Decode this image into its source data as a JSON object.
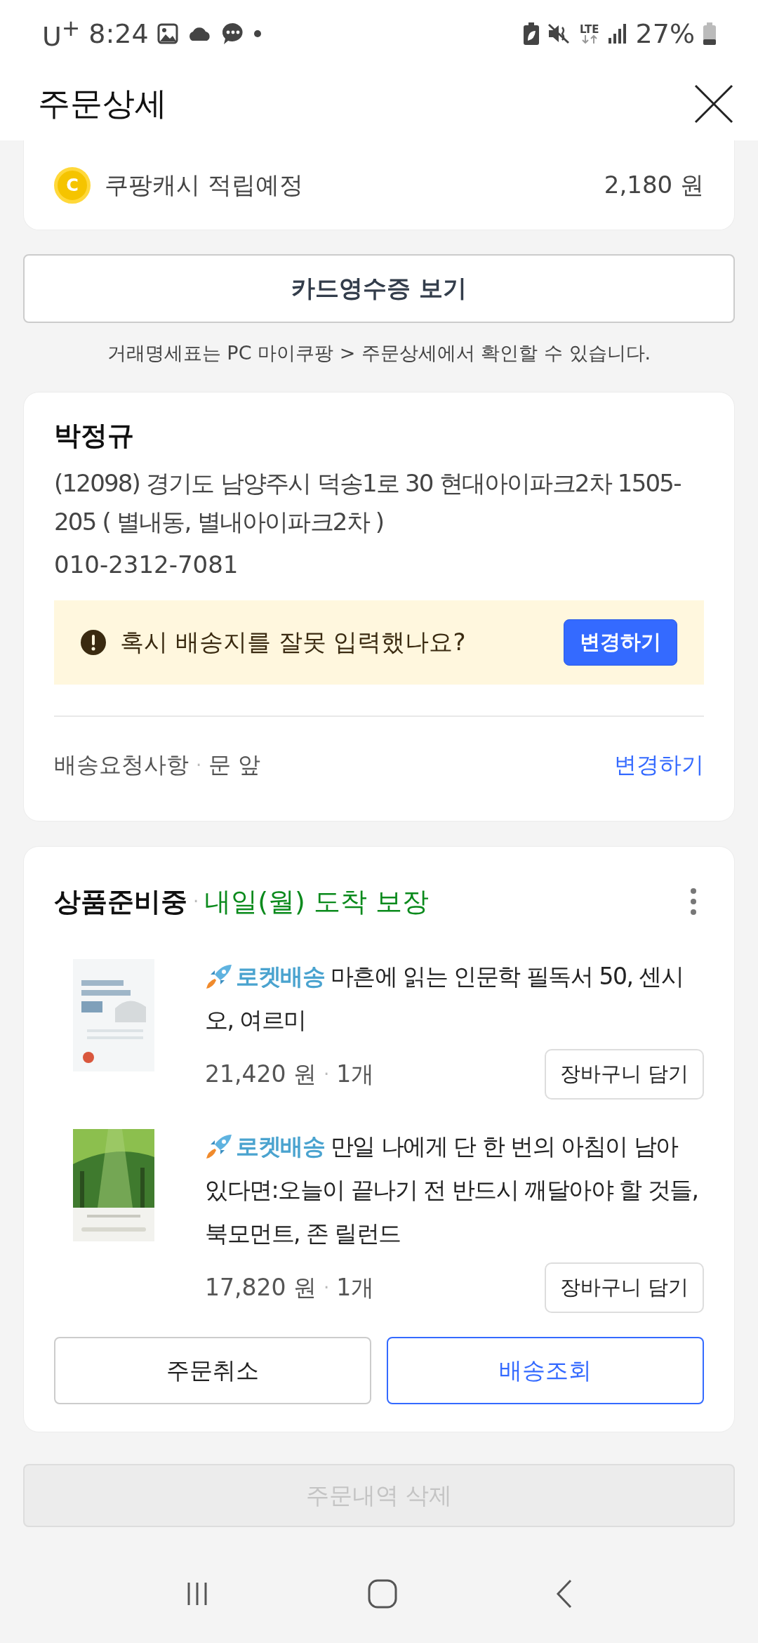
{
  "status_bar": {
    "carrier": "U$^{+}$",
    "time": "8:24",
    "network": "LTE",
    "battery": "27%"
  },
  "header": {
    "title": "주문상세"
  },
  "cash_row": {
    "coin_label": "C",
    "label": "쿠팡캐시 적립예정",
    "amount": "2,180 원"
  },
  "receipt_button": "카드영수증 보기",
  "notice": "거래명세표는 PC 마이쿠팡 > 주문상세에서 확인할 수 있습니다.",
  "address": {
    "name": "박정규",
    "line": "(12098) 경기도 남양주시 덕송1로 30 현대아이파크2차 1505-205 ( 별내동, 별내아이파크2차 )",
    "phone": "010-2312-7081",
    "warning": {
      "text": "혹시 배송지를 잘못 입력했나요?",
      "button": "변경하기"
    },
    "request": {
      "label": "배송요청사항",
      "separator": "·",
      "value": "문 앞",
      "link": "변경하기"
    }
  },
  "shipment": {
    "status": "상품준비중",
    "separator": "·",
    "delivery": "내일(월) 도착 보장",
    "items": [
      {
        "title": "**로켓배송** 마흔에 읽는 인문학 필독서 50, 센시오, 여르미",
        "price": "21,420 원",
        "separator": "·",
        "quantity": "1개",
        "cart_button": "장바구니 담기"
      },
      {
        "title": "**로켓배송** 만일 나에게 단 한 번의 아침이 남아 있다면:오늘이 끝나기 전 반드시 깨달아야 할 것들, 북모먼트, 존 릴런드",
        "price": "17,820 원",
        "separator": "·",
        "quantity": "1개",
        "cart_button": "장바구니 담기"
      }
    ],
    "buttons": [
      {
        "label": "주문취소",
        "kind": "plain"
      },
      {
        "label": "배송조회",
        "kind": "primary"
      }
    ]
  },
  "delete_button": {
    "label": "주문내역 삭제",
    "disabled": true
  }
}
